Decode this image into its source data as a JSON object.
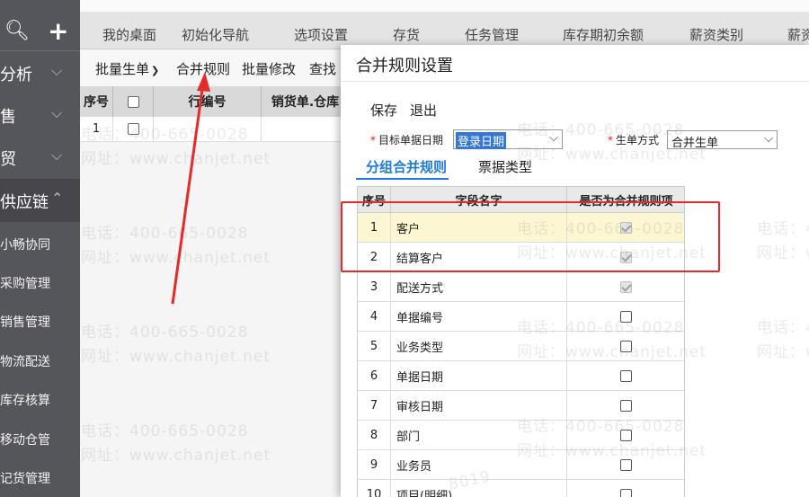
{
  "sidebar": {
    "top_icons": [
      "search-icon",
      "plus-icon"
    ],
    "modules": [
      {
        "label": "分析",
        "chevron": "chevron-down-icon"
      },
      {
        "label": "售",
        "chevron": "chevron-down-icon"
      },
      {
        "label": "贸",
        "chevron": "chevron-down-icon"
      },
      {
        "label": "供应链",
        "chevron": "chevron-up-icon"
      }
    ],
    "sub_items": [
      "小畅协同",
      "采购管理",
      "销售管理",
      "物流配送",
      "库存核算",
      "移动仓管",
      "记货管理"
    ]
  },
  "top_tabs": [
    "我的桌面",
    "初始化导航",
    "选项设置",
    "存货",
    "任务管理",
    "库存期初余额",
    "薪资类别",
    "薪资"
  ],
  "toolbar": {
    "batch_gen": "批量生单",
    "merge_rule": "合并规则",
    "batch_edit": "批量修改",
    "find": "查找"
  },
  "bg_table": {
    "headers": [
      "序号",
      "",
      "行编号",
      "销货单.仓库"
    ],
    "rows": [
      [
        "1",
        ""
      ]
    ]
  },
  "dialog": {
    "title": "合并规则设置",
    "save": "保存",
    "exit": "退出",
    "target_date_label": "目标单据日期",
    "target_date_value": "登录日期",
    "gen_mode_label": "生单方式",
    "gen_mode_value": "合并生单",
    "tabs": [
      "分组合并规则",
      "票据类型"
    ],
    "active_tab": 0,
    "table": {
      "headers": [
        "序号",
        "字段名字",
        "是否为合并规则项"
      ],
      "rows": [
        {
          "no": "1",
          "field": "客户",
          "checked": true,
          "disabled": true,
          "highlight": true
        },
        {
          "no": "2",
          "field": "结算客户",
          "checked": true,
          "disabled": true,
          "highlight": false
        },
        {
          "no": "3",
          "field": "配送方式",
          "checked": true,
          "disabled": true,
          "highlight": false
        },
        {
          "no": "4",
          "field": "单据编号",
          "checked": false,
          "disabled": false,
          "highlight": false
        },
        {
          "no": "5",
          "field": "业务类型",
          "checked": false,
          "disabled": false,
          "highlight": false
        },
        {
          "no": "6",
          "field": "单据日期",
          "checked": false,
          "disabled": false,
          "highlight": false
        },
        {
          "no": "7",
          "field": "审核日期",
          "checked": false,
          "disabled": false,
          "highlight": false
        },
        {
          "no": "8",
          "field": "部门",
          "checked": false,
          "disabled": false,
          "highlight": false
        },
        {
          "no": "9",
          "field": "业务员",
          "checked": false,
          "disabled": false,
          "highlight": false
        },
        {
          "no": "10",
          "field": "项目(明细)",
          "checked": false,
          "disabled": false,
          "highlight": false
        }
      ]
    }
  },
  "watermark": {
    "phone": "电话：400-665-0028",
    "url": "网址：www.chanjet.net",
    "fragment": "8019"
  },
  "colors": {
    "sidebar_bg": "#55555c",
    "accent_blue": "#1e7bd7",
    "annotation_red": "#e62a2a",
    "highlight_row": "#fdf6d2"
  }
}
